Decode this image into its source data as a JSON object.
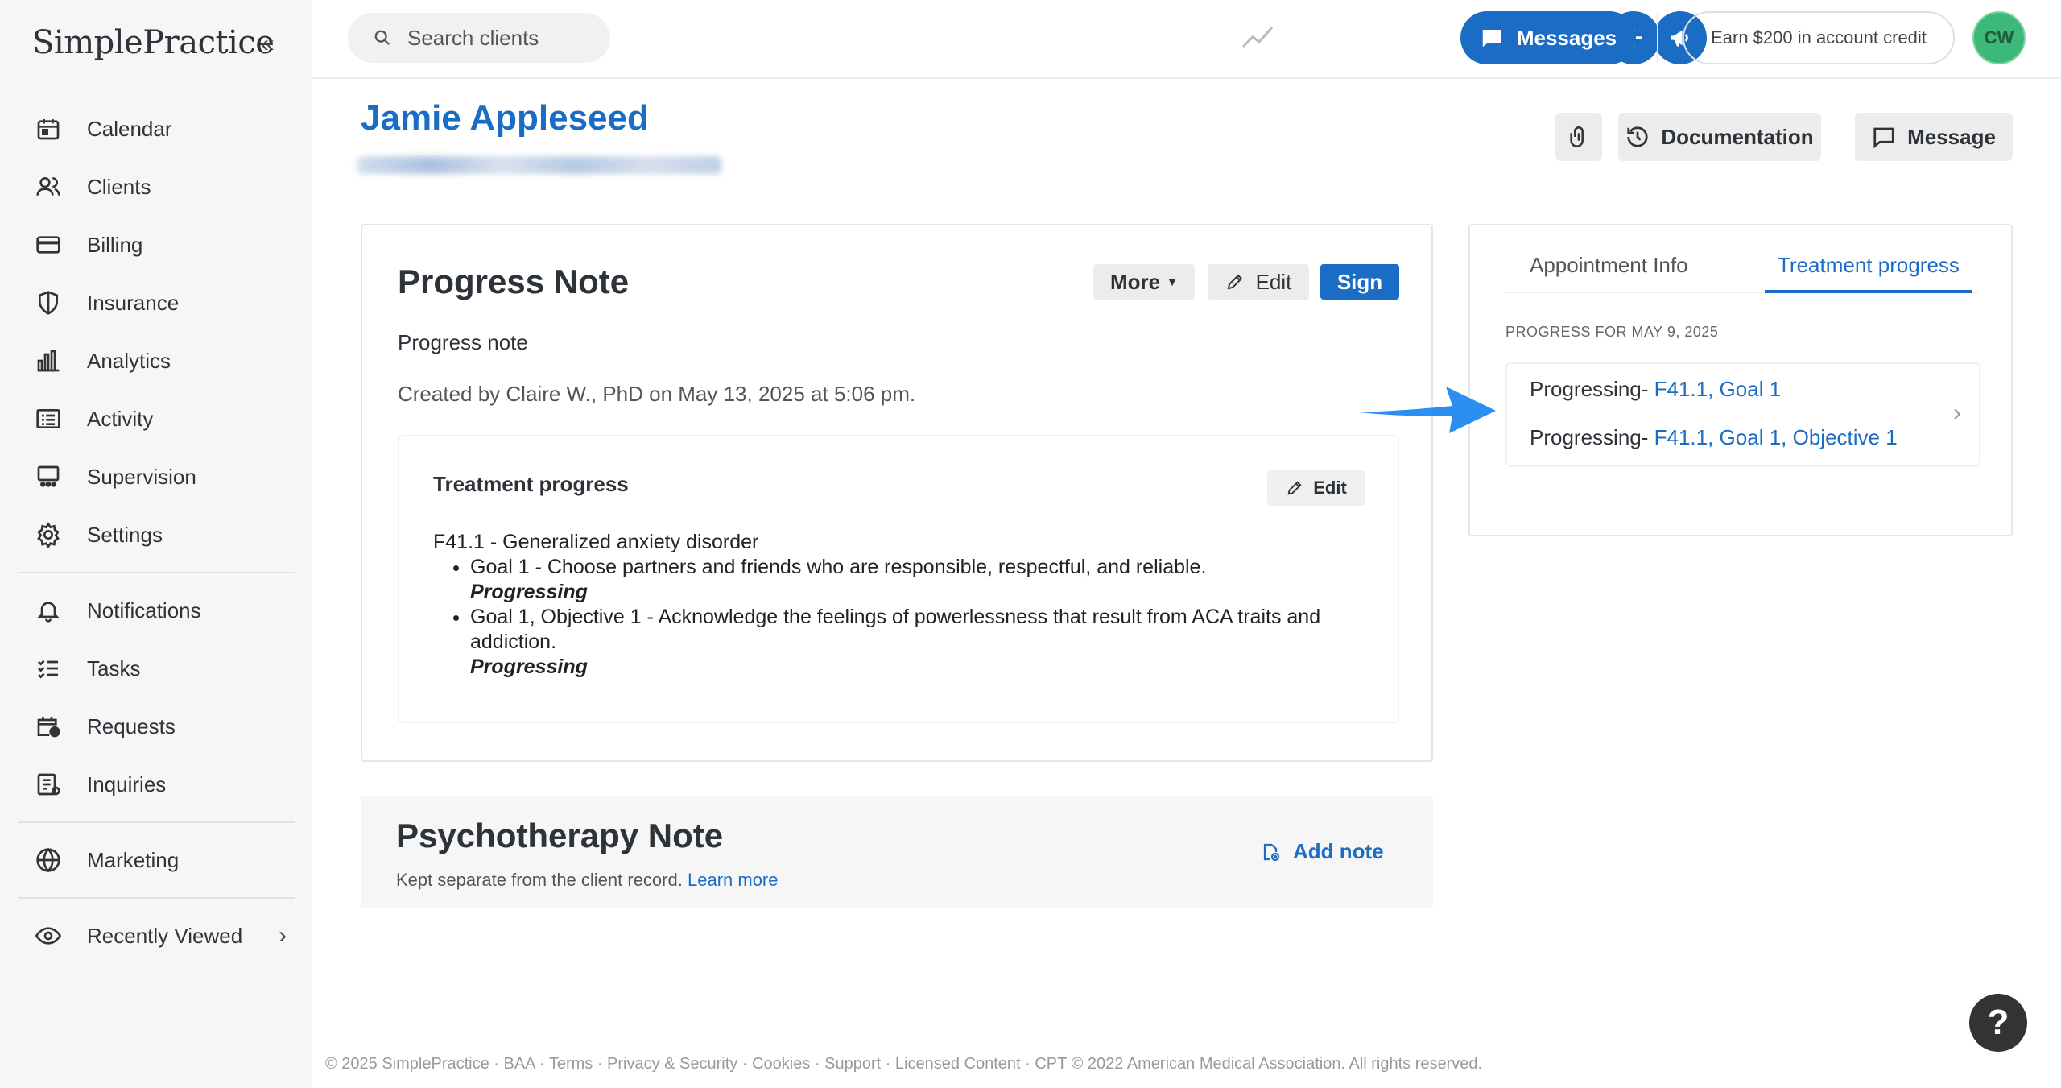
{
  "app": {
    "logo": "SimplePractice",
    "collapse_icon": "double-chevron-left-icon"
  },
  "sidebar": {
    "items": [
      {
        "label": "Calendar",
        "icon": "calendar-icon"
      },
      {
        "label": "Clients",
        "icon": "users-icon"
      },
      {
        "label": "Billing",
        "icon": "credit-card-icon"
      },
      {
        "label": "Insurance",
        "icon": "shield-icon"
      },
      {
        "label": "Analytics",
        "icon": "bar-chart-icon"
      },
      {
        "label": "Activity",
        "icon": "list-icon"
      },
      {
        "label": "Supervision",
        "icon": "supervision-icon"
      },
      {
        "label": "Settings",
        "icon": "gear-icon"
      }
    ],
    "items2": [
      {
        "label": "Notifications",
        "icon": "bell-icon"
      },
      {
        "label": "Tasks",
        "icon": "tasks-icon"
      },
      {
        "label": "Requests",
        "icon": "calendar-clock-icon"
      },
      {
        "label": "Inquiries",
        "icon": "inquiries-icon"
      }
    ],
    "marketing": "Marketing",
    "recently_viewed": "Recently Viewed"
  },
  "topbar": {
    "search_placeholder": "Search clients",
    "messages_label": "Messages",
    "earn_label": "Earn $200 in account credit",
    "avatar_initials": "CW"
  },
  "client": {
    "name": "Jamie Appleseed",
    "documentation_label": "Documentation",
    "message_label": "Message"
  },
  "progress_note": {
    "title": "Progress Note",
    "more_label": "More",
    "edit_label": "Edit",
    "sign_label": "Sign",
    "note_type": "Progress note",
    "created": "Created by Claire W., PhD on May 13, 2025 at 5:06 pm.",
    "treatment": {
      "title": "Treatment progress",
      "edit_label": "Edit",
      "diagnosis": "F41.1 - Generalized anxiety disorder",
      "goals": [
        {
          "text": "Goal 1 - Choose partners and friends who are responsible, respectful, and reliable.",
          "status": "Progressing"
        },
        {
          "text": "Goal 1, Objective 1 - Acknowledge the feelings of powerlessness that result from ACA traits and addiction.",
          "status": "Progressing"
        }
      ]
    }
  },
  "psychotherapy": {
    "title": "Psychotherapy Note",
    "subtitle": "Kept separate from the client record.",
    "learn_more": "Learn more",
    "add_note": "Add note"
  },
  "panel": {
    "tabs": [
      "Appointment Info",
      "Treatment progress"
    ],
    "progress_label": "PROGRESS FOR MAY 9, 2025",
    "lines": [
      {
        "prefix": "Progressing- ",
        "link": "F41.1, Goal 1"
      },
      {
        "prefix": "Progressing- ",
        "link": "F41.1, Goal 1, Objective 1"
      }
    ]
  },
  "footer": "© 2025 SimplePractice · BAA · Terms · Privacy & Security · Cookies · Support · Licensed Content · CPT © 2022 American Medical Association. All rights reserved.",
  "help_label": "?",
  "colors": {
    "accent": "#1a6cc4",
    "avatar": "#3cb879",
    "annotation_arrow": "#2a8ff0"
  }
}
